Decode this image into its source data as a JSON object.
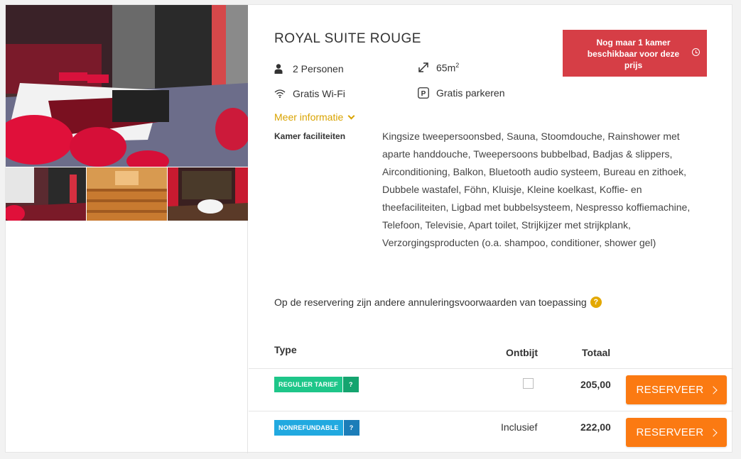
{
  "room": {
    "title": "ROYAL SUITE ROUGE",
    "availability": "Nog maar 1 kamer beschikbaar voor deze prijs",
    "features": {
      "persons": "2 Personen",
      "size": "65m",
      "size_sup": "2",
      "wifi": "Gratis Wi-Fi",
      "parking": "Gratis parkeren"
    },
    "more_info": "Meer informatie",
    "facilities_label": "Kamer faciliteiten",
    "facilities_text": "Kingsize tweepersoonsbed, Sauna, Stoomdouche, Rainshower met aparte handdouche, Tweepersoons bubbelbad, Badjas & slippers, Airconditioning, Balkon, Bluetooth audio systeem, Bureau en zithoek, Dubbele wastafel, Föhn, Kluisje, Kleine koelkast, Koffie- en theefaciliteiten, Ligbad met bubbelsysteem, Nespresso koffiemachine, Telefoon, Televisie, Apart toilet, Strijkijzer met strijkplank, Verzorgingsproducten (o.a. shampoo, conditioner, shower gel)",
    "cancellation_note": "Op de reservering zijn andere annuleringsvoorwaarden van toepassing"
  },
  "table": {
    "headers": {
      "type": "Type",
      "breakfast": "Ontbijt",
      "total": "Totaal"
    },
    "rows": [
      {
        "tag": "REGULIER TARIEF",
        "tag_q": "?",
        "breakfast": "",
        "price": "205,00",
        "button": "RESERVEER"
      },
      {
        "tag": "NONREFUNDABLE",
        "tag_q": "?",
        "breakfast": "Inclusief",
        "price": "222,00",
        "button": "RESERVEER"
      }
    ]
  },
  "colors": {
    "accent_orange": "#fb7a12",
    "availability_red": "#d63e46",
    "link_gold": "#d9a300",
    "tag_green": "#1ec689",
    "tag_blue": "#21a9e0"
  }
}
